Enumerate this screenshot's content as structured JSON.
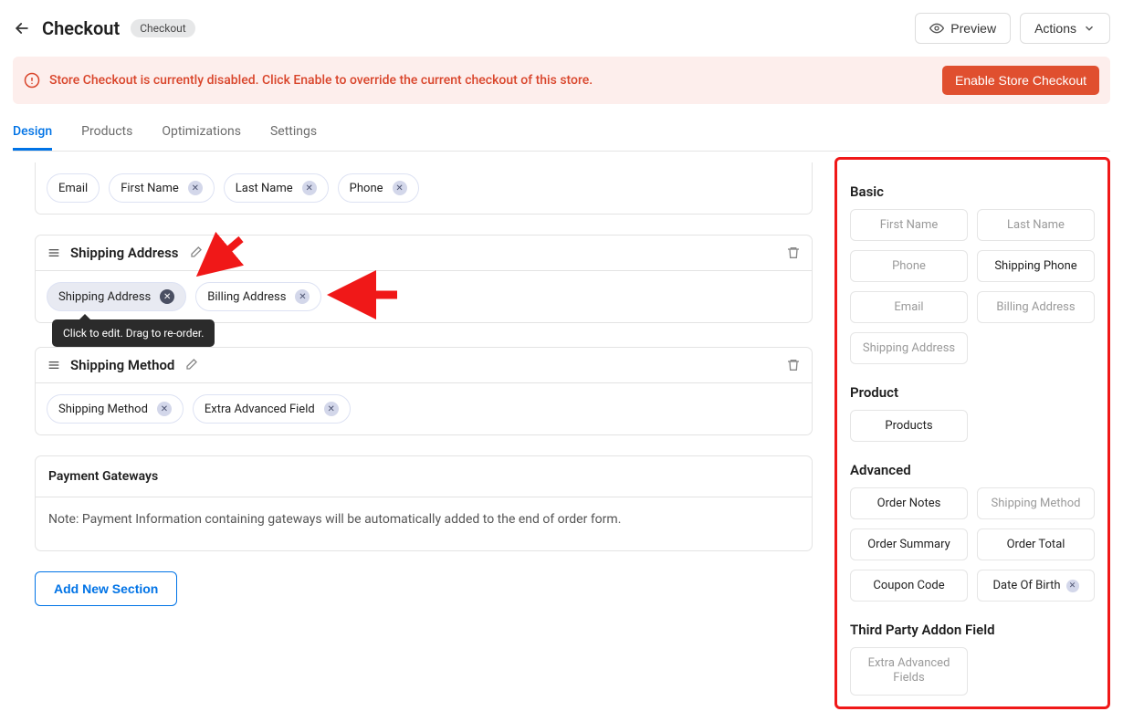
{
  "header": {
    "title": "Checkout",
    "tag": "Checkout",
    "preview_label": "Preview",
    "actions_label": "Actions"
  },
  "alert": {
    "text": "Store Checkout is currently disabled. Click Enable to override the current checkout of this store.",
    "button": "Enable Store Checkout"
  },
  "tabs": {
    "design": "Design",
    "products": "Products",
    "optimizations": "Optimizations",
    "settings": "Settings"
  },
  "sections": {
    "contact_chips": [
      "Email",
      "First Name",
      "Last Name",
      "Phone"
    ],
    "shipping_address": {
      "title": "Shipping Address",
      "chips": [
        "Shipping Address",
        "Billing Address"
      ]
    },
    "shipping_method": {
      "title": "Shipping Method",
      "chips": [
        "Shipping Method",
        "Extra Advanced Field"
      ]
    },
    "payment": {
      "title": "Payment Gateways",
      "note": "Note: Payment Information containing gateways will be automatically added to the end of order form."
    },
    "add_section": "Add New Section"
  },
  "tooltip": "Click to edit. Drag to re-order.",
  "sidebar": {
    "basic": {
      "title": "Basic",
      "items": [
        {
          "label": "First Name",
          "available": false
        },
        {
          "label": "Last Name",
          "available": false
        },
        {
          "label": "Phone",
          "available": false
        },
        {
          "label": "Shipping Phone",
          "available": true
        },
        {
          "label": "Email",
          "available": false
        },
        {
          "label": "Billing Address",
          "available": false
        },
        {
          "label": "Shipping Address",
          "available": false
        }
      ]
    },
    "product": {
      "title": "Product",
      "items": [
        {
          "label": "Products",
          "available": true
        }
      ]
    },
    "advanced": {
      "title": "Advanced",
      "items": [
        {
          "label": "Order Notes",
          "available": true
        },
        {
          "label": "Shipping Method",
          "available": false
        },
        {
          "label": "Order Summary",
          "available": true
        },
        {
          "label": "Order Total",
          "available": true
        },
        {
          "label": "Coupon Code",
          "available": true
        },
        {
          "label": "Date Of Birth",
          "available": true,
          "removable": true
        }
      ]
    },
    "third_party": {
      "title": "Third Party Addon Field",
      "items": [
        {
          "label": "Extra Advanced Fields",
          "available": false
        }
      ]
    }
  }
}
